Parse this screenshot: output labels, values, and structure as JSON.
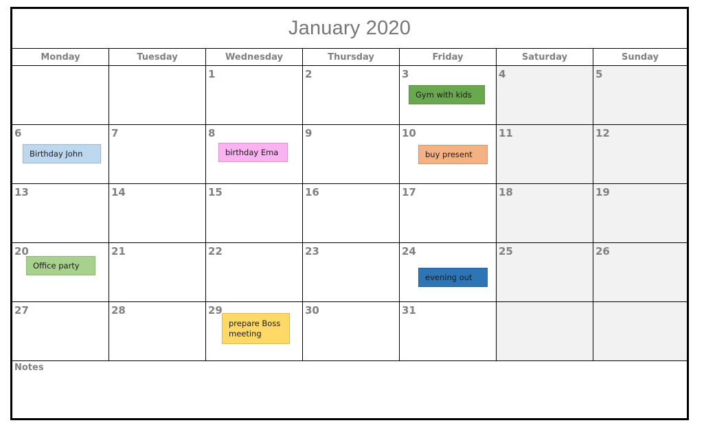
{
  "calendar": {
    "title": "January 2020",
    "weekdays": [
      "Monday",
      "Tuesday",
      "Wednesday",
      "Thursday",
      "Friday",
      "Saturday",
      "Sunday"
    ],
    "weekend_color": "#f2f2f2",
    "weeks": [
      [
        "",
        "",
        "1",
        "2",
        "3",
        "4",
        "5"
      ],
      [
        "6",
        "7",
        "8",
        "9",
        "10",
        "11",
        "12"
      ],
      [
        "13",
        "14",
        "15",
        "16",
        "17",
        "18",
        "19"
      ],
      [
        "20",
        "21",
        "22",
        "23",
        "24",
        "25",
        "26"
      ],
      [
        "27",
        "28",
        "29",
        "30",
        "31",
        "",
        ""
      ]
    ],
    "events": [
      {
        "day": "3",
        "label": "Gym with kids",
        "color": "#6aa84f"
      },
      {
        "day": "6",
        "label": "Birthday John",
        "color": "#bdd7ee"
      },
      {
        "day": "8",
        "label": "birthday Ema",
        "color": "#f9b3f0"
      },
      {
        "day": "10",
        "label": "buy present",
        "color": "#f4b183"
      },
      {
        "day": "20",
        "label": "Office party",
        "color": "#a9d18e"
      },
      {
        "day": "24",
        "label": "evening out",
        "color": "#2e75b6"
      },
      {
        "day": "29",
        "label": "prepare Boss meeting",
        "color": "#ffd966"
      }
    ],
    "notes_label": "Notes"
  }
}
